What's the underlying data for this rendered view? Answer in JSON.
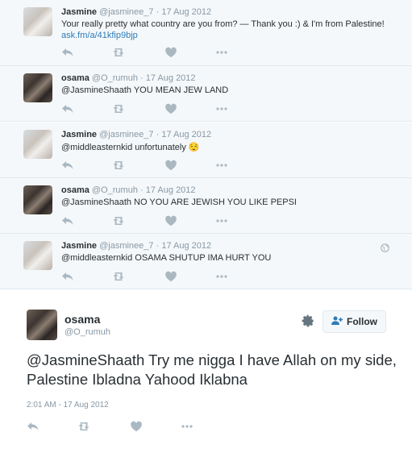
{
  "thread": [
    {
      "avatar": "jasmine",
      "name": "Jasmine",
      "handle": "@jasminee_7",
      "separator": "·",
      "date": "17 Aug 2012",
      "text": "Your really pretty what country are you from? — Thank you :) & I'm from Palestine!",
      "link": "ask.fm/a/41kfip9bjp"
    },
    {
      "avatar": "osama",
      "name": "osama",
      "handle": "@O_rumuh",
      "separator": "·",
      "date": "17 Aug 2012",
      "text": "@JasmineShaath YOU MEAN JEW LAND"
    },
    {
      "avatar": "jasmine",
      "name": "Jasmine",
      "handle": "@jasminee_7",
      "separator": "·",
      "date": "17 Aug 2012",
      "text": "@middleasternkid unfortunately 😌"
    },
    {
      "avatar": "osama",
      "name": "osama",
      "handle": "@O_rumuh",
      "separator": "·",
      "date": "17 Aug 2012",
      "text": "@JasmineShaath NO YOU ARE JEWISH YOU LIKE PEPSI"
    },
    {
      "avatar": "jasmine",
      "name": "Jasmine",
      "handle": "@jasminee_7",
      "separator": "·",
      "date": "17 Aug 2012",
      "text": "@middleasternkid OSAMA SHUTUP IMA HURT YOU",
      "globe_icon": "globe-icon"
    }
  ],
  "main": {
    "name": "osama",
    "handle": "@O_rumuh",
    "follow_label": "Follow",
    "text": "@JasmineShaath Try me nigga I have Allah on my side, Palestine Ibladna Yahood Iklabna",
    "timestamp": "2:01 AM - 17 Aug 2012"
  },
  "icons": {
    "reply": "reply-icon",
    "retweet": "retweet-icon",
    "like": "heart-icon",
    "more": "more-icon",
    "settings": "gear-icon",
    "follow": "add-user-icon"
  },
  "colors": {
    "reply_bg": "#f5f8fa",
    "icon": "#aab8c2",
    "link": "#2b7bb9",
    "muted": "#8899a6",
    "text": "#292f33",
    "border": "#e1e8ed",
    "follow_icon": "#2b7bb9"
  }
}
